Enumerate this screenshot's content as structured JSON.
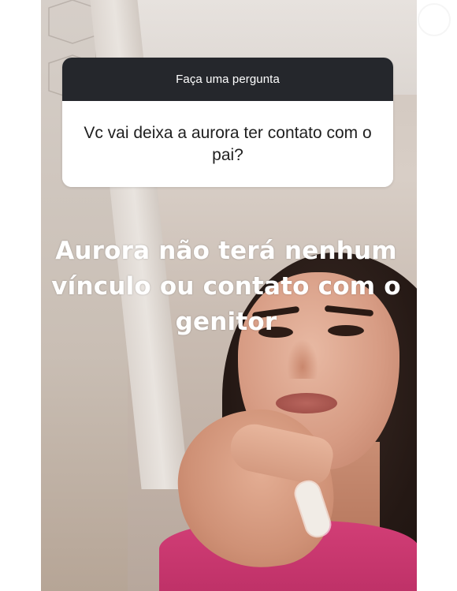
{
  "story": {
    "question_sticker": {
      "header": "Faça uma pergunta",
      "question": "Vc vai deixa a aurora ter contato com o pai?"
    },
    "answer_text": "Aurora não terá nenhum vínculo ou contato com o genitor",
    "colors": {
      "sticker_header_bg": "#25272c",
      "sticker_body_bg": "#ffffff",
      "answer_text": "#ffffff",
      "shirt": "#d23e76"
    }
  }
}
